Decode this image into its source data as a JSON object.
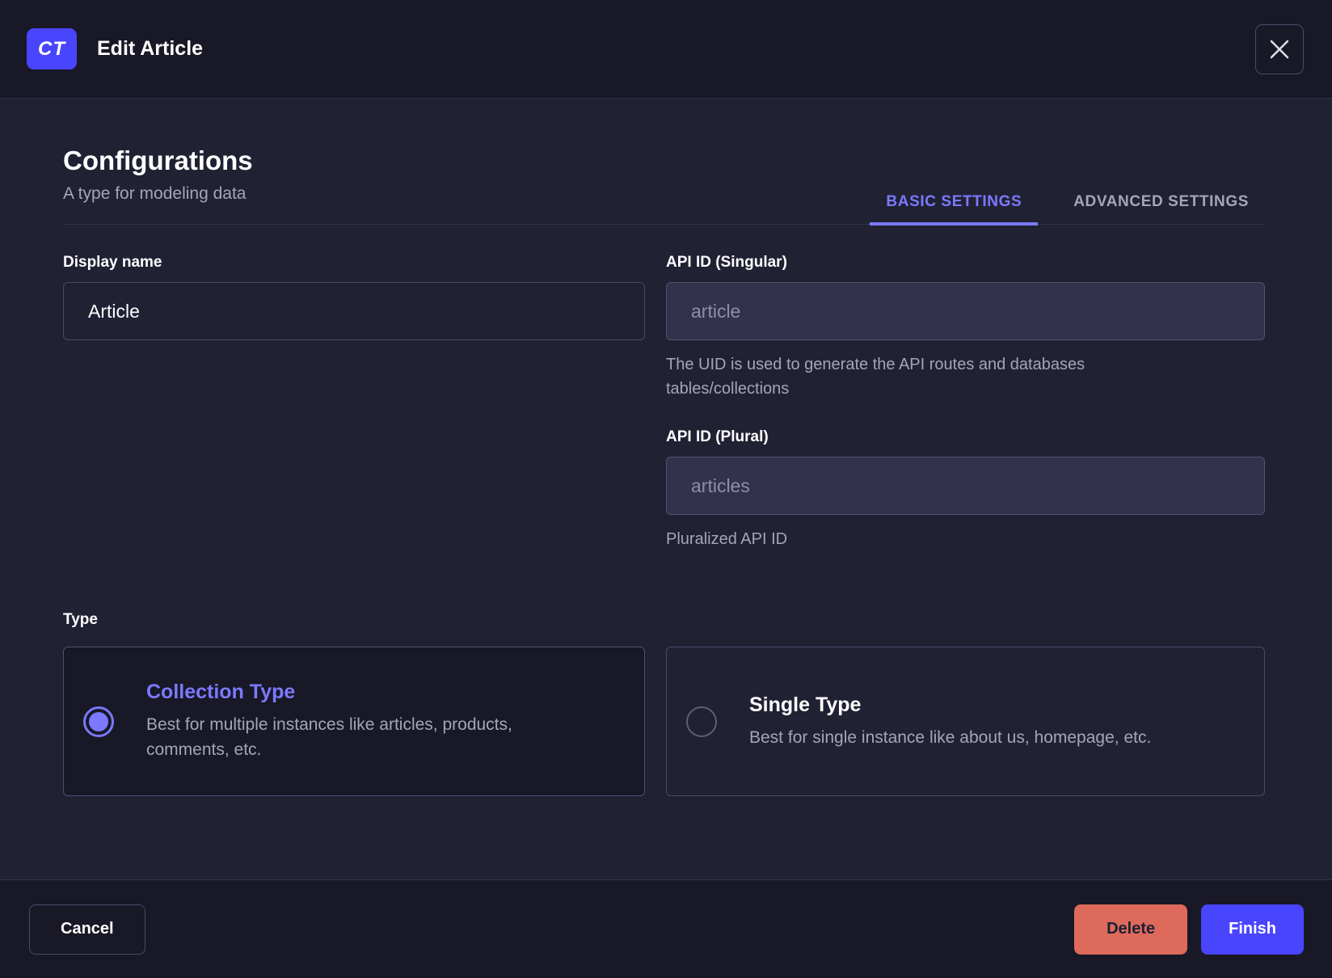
{
  "colors": {
    "primary": "#4945ff",
    "primary_light": "#7b79ff",
    "danger": "#dd6a5b",
    "header_bg": "#181826",
    "body_bg": "#212134"
  },
  "header": {
    "badge": "CT",
    "title": "Edit Article",
    "close_icon": "x-icon"
  },
  "intro": {
    "title": "Configurations",
    "subtitle": "A type for modeling data"
  },
  "tabs": [
    {
      "label": "BASIC SETTINGS",
      "active": true
    },
    {
      "label": "ADVANCED SETTINGS",
      "active": false
    }
  ],
  "form": {
    "display_name": {
      "label": "Display name",
      "value": "Article"
    },
    "api_id_singular": {
      "label": "API ID (Singular)",
      "value": "article",
      "hint": "The UID is used to generate the API routes and databases tables/collections"
    },
    "api_id_plural": {
      "label": "API ID (Plural)",
      "value": "articles",
      "hint": "Pluralized API ID"
    },
    "type": {
      "label": "Type",
      "options": [
        {
          "title": "Collection Type",
          "description": "Best for multiple instances like articles, products, comments, etc.",
          "selected": true
        },
        {
          "title": "Single Type",
          "description": "Best for single instance like about us, homepage, etc.",
          "selected": false
        }
      ]
    }
  },
  "footer": {
    "cancel": "Cancel",
    "delete": "Delete",
    "finish": "Finish"
  }
}
